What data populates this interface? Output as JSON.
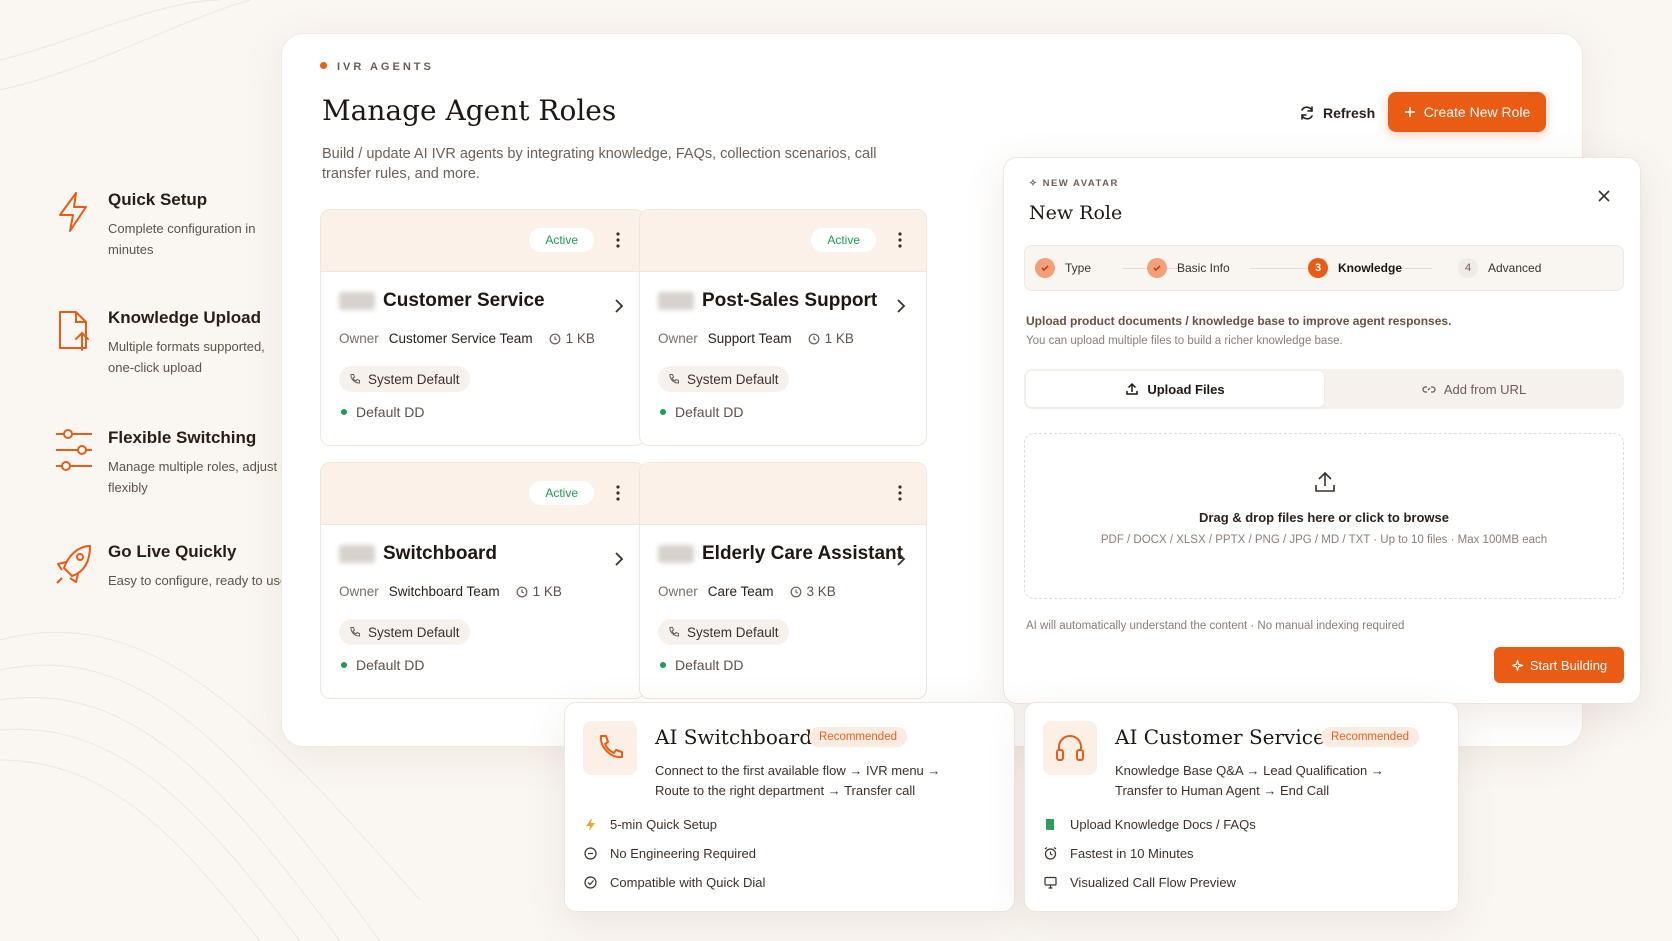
{
  "features": [
    {
      "icon": "lightning-icon",
      "title": "Quick Setup",
      "desc": "Complete configuration in minutes"
    },
    {
      "icon": "file-upload-icon",
      "title": "Knowledge Upload",
      "desc": "Multiple formats supported, one-click upload"
    },
    {
      "icon": "sliders-icon",
      "title": "Flexible Switching",
      "desc": "Manage multiple roles, adjust flexibly"
    },
    {
      "icon": "rocket-icon",
      "title": "Go Live Quickly",
      "desc": "Easy to configure, ready to use"
    }
  ],
  "header": {
    "eyebrow": "IVR AGENTS",
    "title": "Manage Agent Roles",
    "description": "Build / update AI IVR agents by integrating knowledge, FAQs, collection scenarios, call transfer rules, and more.",
    "refresh_label": "Refresh",
    "create_label": "Create New Role"
  },
  "cards": [
    {
      "badge": "Active",
      "name": "Customer Service",
      "owner_label": "Owner",
      "owner": "Customer Service Team",
      "size": "1 KB",
      "tag": "System Default",
      "dd": "Default DD"
    },
    {
      "badge": "Active",
      "name": "Post-Sales Support",
      "owner_label": "Owner",
      "owner": "Support Team",
      "size": "1 KB",
      "tag": "System Default",
      "dd": "Default DD"
    },
    {
      "badge": "Active",
      "name": "Switchboard",
      "owner_label": "Owner",
      "owner": "Switchboard Team",
      "size": "1 KB",
      "tag": "System Default",
      "dd": "Default DD"
    },
    {
      "badge": "",
      "name": "Elderly Care Assistant",
      "owner_label": "Owner",
      "owner": "Care Team",
      "size": "3 KB",
      "tag": "System Default",
      "dd": "Default DD"
    }
  ],
  "new_role": {
    "eyebrow": "NEW AVATAR",
    "title": "New Role",
    "steps": [
      {
        "num": "",
        "label": "Type",
        "state": "done"
      },
      {
        "num": "",
        "label": "Basic Info",
        "state": "done"
      },
      {
        "num": "3",
        "label": "Knowledge",
        "state": "current"
      },
      {
        "num": "4",
        "label": "Advanced",
        "state": "todo"
      }
    ],
    "upload_title": "Upload product documents / knowledge base to improve agent responses.",
    "upload_sub": "You can upload multiple files to build a richer knowledge base.",
    "tab_upload": "Upload Files",
    "tab_url": "Add from URL",
    "drop_title": "Drag & drop files here or click to browse",
    "drop_formats": "PDF / DOCX / XLSX / PPTX / PNG / JPG / MD / TXT  ·  Up to 10 files  ·  Max 100MB each",
    "note": "AI will automatically understand the content  ·  No manual indexing required",
    "start_label": "Start Building"
  },
  "bottom_cards": [
    {
      "icon": "phone-icon",
      "title": "AI Switchboard",
      "badge": "Recommended",
      "desc": "Connect to the first available flow → IVR menu → Route to the right department → Transfer call",
      "items": [
        {
          "icon": "lightning-icon",
          "text": "5-min Quick Setup"
        },
        {
          "icon": "no-code-icon",
          "text": "No Engineering Required"
        },
        {
          "icon": "check-circle-icon",
          "text": "Compatible with Quick Dial"
        }
      ]
    },
    {
      "icon": "headset-icon",
      "title": "AI Customer Service",
      "badge": "Recommended",
      "desc": "Knowledge Base Q&A → Lead Qualification → Transfer to Human Agent → End Call",
      "items": [
        {
          "icon": "book-icon",
          "text": "Upload Knowledge Docs / FAQs"
        },
        {
          "icon": "alarm-icon",
          "text": "Fastest in 10 Minutes"
        },
        {
          "icon": "monitor-icon",
          "text": "Visualized Call Flow Preview"
        }
      ]
    }
  ],
  "colors": {
    "accent": "#ea5b13",
    "active": "#1f9b55",
    "background": "#faf6f2"
  }
}
